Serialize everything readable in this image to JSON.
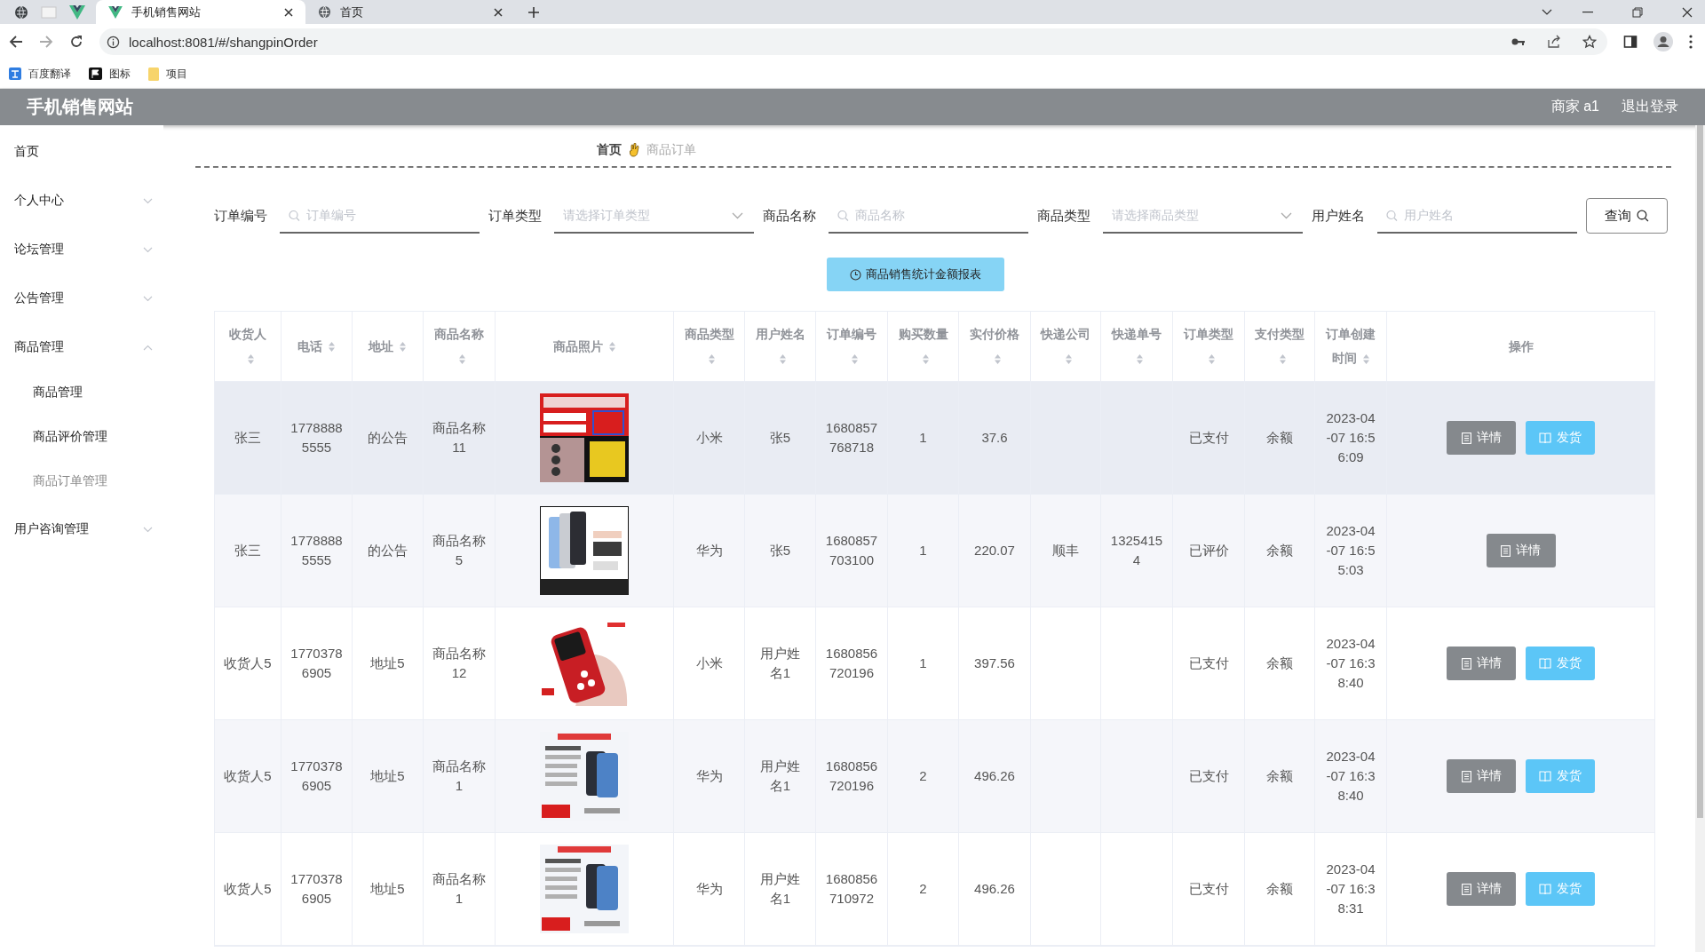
{
  "browser": {
    "tabs": [
      {
        "title": "手机销售网站",
        "selected": true,
        "kind": "vue"
      },
      {
        "title": "首页",
        "selected": false,
        "kind": "globe"
      }
    ],
    "address": "localhost:8081/#/shangpinOrder",
    "bookmarks": [
      {
        "label": "百度翻译",
        "kind": "translate"
      },
      {
        "label": "图标",
        "kind": "flag"
      },
      {
        "label": "项目",
        "kind": "folder"
      }
    ]
  },
  "header": {
    "title": "手机销售网站",
    "user": "商家 a1",
    "logout": "退出登录"
  },
  "sidebar": {
    "items": [
      {
        "label": "首页",
        "kind": "link"
      },
      {
        "label": "个人中心",
        "kind": "menu",
        "expanded": false
      },
      {
        "label": "论坛管理",
        "kind": "menu",
        "expanded": false
      },
      {
        "label": "公告管理",
        "kind": "menu",
        "expanded": false
      },
      {
        "label": "商品管理",
        "kind": "menu",
        "expanded": true,
        "children": [
          {
            "label": "商品管理",
            "selected": false
          },
          {
            "label": "商品评价管理",
            "selected": false
          },
          {
            "label": "商品订单管理",
            "selected": true
          }
        ]
      },
      {
        "label": "用户咨询管理",
        "kind": "menu",
        "expanded": false
      }
    ]
  },
  "breadcrumb": [
    "首页",
    "商品订单"
  ],
  "filters": [
    {
      "label": "订单编号",
      "kind": "search",
      "placeholder": "订单编号"
    },
    {
      "label": "订单类型",
      "kind": "select",
      "placeholder": "请选择订单类型"
    },
    {
      "label": "商品名称",
      "kind": "search",
      "placeholder": "商品名称"
    },
    {
      "label": "商品类型",
      "kind": "select",
      "placeholder": "请选择商品类型"
    },
    {
      "label": "用户姓名",
      "kind": "search",
      "placeholder": "用户姓名"
    }
  ],
  "query_button": "查询",
  "report_button": "商品销售统计金额报表",
  "table": {
    "columns": [
      {
        "label": "收货人",
        "sortable": true
      },
      {
        "label": "电话",
        "sortable": true
      },
      {
        "label": "地址",
        "sortable": true
      },
      {
        "label": "商品名称",
        "sortable": true
      },
      {
        "label": "商品照片",
        "sortable": true
      },
      {
        "label": "商品类型",
        "sortable": true
      },
      {
        "label": "用户姓名",
        "sortable": true
      },
      {
        "label": "订单编号",
        "sortable": true
      },
      {
        "label": "购买数量",
        "sortable": true
      },
      {
        "label": "实付价格",
        "sortable": true
      },
      {
        "label": "快递公司",
        "sortable": true
      },
      {
        "label": "快递单号",
        "sortable": true
      },
      {
        "label": "订单类型",
        "sortable": true
      },
      {
        "label": "支付类型",
        "sortable": true
      },
      {
        "label": "订单创建时间",
        "sortable": true
      },
      {
        "label": "操作",
        "sortable": false
      }
    ],
    "rows": [
      {
        "receiver": "张三",
        "phone": "17788885555",
        "address": "的公告",
        "product_name": "商品名称11",
        "photo": {
          "kind": "picture"
        },
        "product_type": "小米",
        "user_name": "张5",
        "order_no": "1680857768718",
        "quantity": "1",
        "paid": "37.6",
        "order_type": "已支付",
        "pay_type": "余额",
        "created": "2023-04-07 16:56:09",
        "hovered": true,
        "actions": [
          {
            "label": "详情",
            "kind": "detail"
          },
          {
            "label": "发货",
            "kind": "ship"
          }
        ]
      },
      {
        "receiver": "张三",
        "phone": "17788885555",
        "address": "的公告",
        "product_name": "商品名称5",
        "photo": {
          "kind": "picture"
        },
        "product_type": "华为",
        "user_name": "张5",
        "order_no": "1680857703100",
        "quantity": "1",
        "paid": "220.07",
        "courier": "顺丰",
        "tracking_no": "13254154",
        "order_type": "已评价",
        "pay_type": "余额",
        "created": "2023-04-07 16:55:03",
        "hovered": false,
        "actions": [
          {
            "label": "详情",
            "kind": "detail"
          }
        ]
      },
      {
        "receiver": "收货人5",
        "phone": "17703786905",
        "address": "地址5",
        "product_name": "商品名称12",
        "photo": {
          "kind": "picture"
        },
        "product_type": "小米",
        "user_name": "用户姓名1",
        "order_no": "1680856720196",
        "quantity": "1",
        "paid": "397.56",
        "order_type": "已支付",
        "pay_type": "余额",
        "created": "2023-04-07 16:38:40",
        "hovered": false,
        "actions": [
          {
            "label": "详情",
            "kind": "detail"
          },
          {
            "label": "发货",
            "kind": "ship"
          }
        ]
      },
      {
        "receiver": "收货人5",
        "phone": "17703786905",
        "address": "地址5",
        "product_name": "商品名称1",
        "photo": {
          "kind": "picture"
        },
        "product_type": "华为",
        "user_name": "用户姓名1",
        "order_no": "1680856720196",
        "quantity": "2",
        "paid": "496.26",
        "order_type": "已支付",
        "pay_type": "余额",
        "created": "2023-04-07 16:38:40",
        "hovered": false,
        "actions": [
          {
            "label": "详情",
            "kind": "detail"
          },
          {
            "label": "发货",
            "kind": "ship"
          }
        ]
      },
      {
        "receiver": "收货人5",
        "phone": "17703786905",
        "address": "地址5",
        "product_name": "商品名称1",
        "photo": {
          "kind": "picture"
        },
        "product_type": "华为",
        "user_name": "用户姓名1",
        "order_no": "1680856710972",
        "quantity": "2",
        "paid": "496.26",
        "order_type": "已支付",
        "pay_type": "余额",
        "created": "2023-04-07 16:38:31",
        "hovered": false,
        "actions": [
          {
            "label": "详情",
            "kind": "detail"
          },
          {
            "label": "发货",
            "kind": "ship"
          }
        ]
      }
    ]
  }
}
